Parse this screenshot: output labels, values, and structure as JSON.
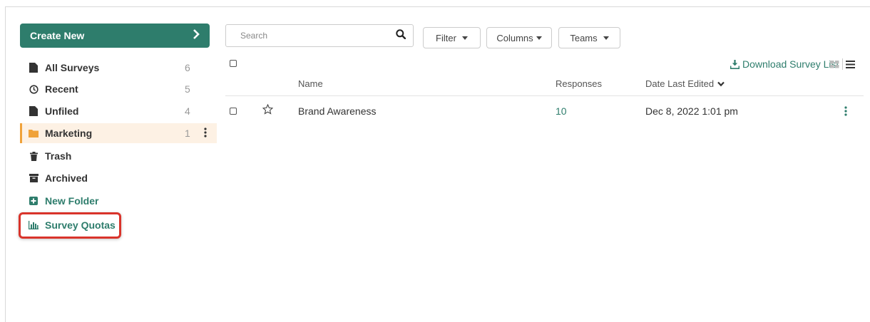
{
  "sidebar": {
    "create_new": "Create New",
    "items": [
      {
        "label": "All Surveys",
        "count": "6",
        "icon": "file-icon"
      },
      {
        "label": "Recent",
        "count": "5",
        "icon": "clock-icon"
      },
      {
        "label": "Unfiled",
        "count": "4",
        "icon": "file-icon"
      },
      {
        "label": "Marketing",
        "count": "1",
        "icon": "folder-icon",
        "active": true
      },
      {
        "label": "Trash",
        "icon": "trash-icon"
      },
      {
        "label": "Archived",
        "icon": "archive-icon"
      },
      {
        "label": "New Folder",
        "icon": "plus-square-icon"
      },
      {
        "label": "Survey Quotas",
        "icon": "bar-chart-icon",
        "highlighted": true
      }
    ]
  },
  "toolbar": {
    "search_placeholder": "Search",
    "filter_label": "Filter",
    "columns_label": "Columns",
    "teams_label": "Teams",
    "download_label": "Download Survey List"
  },
  "table": {
    "headers": {
      "name": "Name",
      "responses": "Responses",
      "date": "Date Last Edited"
    },
    "rows": [
      {
        "name": "Brand Awareness",
        "responses": "10",
        "date": "Dec 8, 2022 1:01 pm",
        "starred": false
      }
    ]
  },
  "colors": {
    "accent": "#2e7d6c",
    "active_border": "#f0a23a",
    "highlight_box": "#d9342b"
  }
}
